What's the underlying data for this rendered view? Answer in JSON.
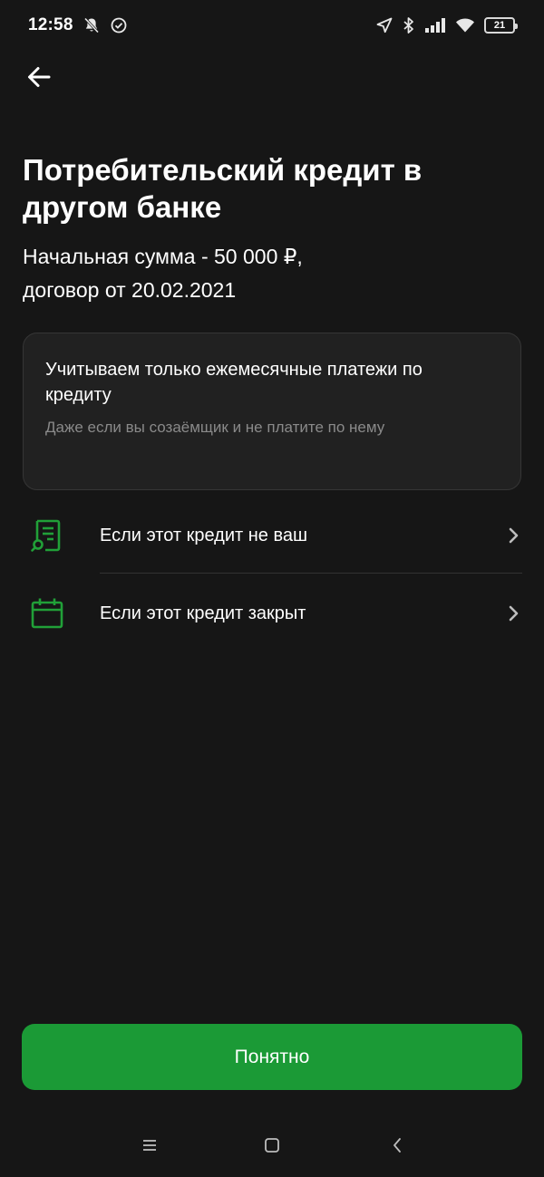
{
  "status_bar": {
    "time": "12:58",
    "battery_level": "21",
    "icons_left": [
      "bell-off-icon",
      "check-circle-icon"
    ],
    "icons_right": [
      "location-icon",
      "bluetooth-icon",
      "signal-icon",
      "wifi-icon",
      "battery-icon"
    ]
  },
  "header": {
    "back_icon": "arrow-left-icon"
  },
  "main": {
    "title": "Потребительский кредит в другом банке",
    "subtitle_line1": "Начальная сумма - 50 000 ₽,",
    "subtitle_line2": "договор от 20.02.2021",
    "info_card": {
      "title": "Учитываем только ежемесячные платежи по кредиту",
      "note": "Даже если вы созаёмщик и не платите по нему"
    },
    "list": [
      {
        "label": "Если этот кредит не ваш",
        "icon": "document-search-icon"
      },
      {
        "label": "Если этот кредит закрыт",
        "icon": "calendar-icon"
      }
    ]
  },
  "footer": {
    "primary_button": "Понятно"
  },
  "nav_bar": {
    "icons": [
      "menu-icon",
      "home-square-icon",
      "back-chevron-icon"
    ]
  },
  "colors": {
    "background": "#161616",
    "card": "#212121",
    "accent_green": "#1b9a36",
    "icon_green": "#21a038",
    "muted_text": "#8a8a8a"
  }
}
